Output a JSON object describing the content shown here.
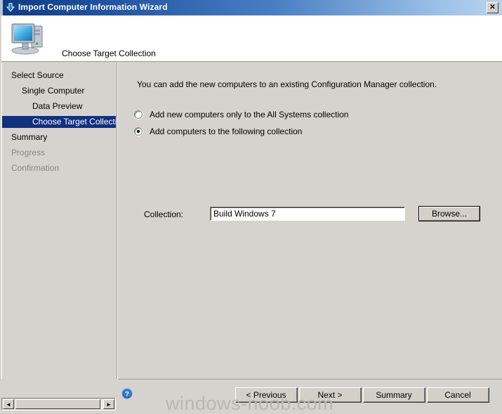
{
  "window": {
    "title": "Import Computer Information Wizard",
    "title_icon": "blue-down-arrow-icon",
    "close_label": "✕",
    "accent_color": "#1d4f9e",
    "body_color": "#d6d3ce",
    "selection_color": "#11307e"
  },
  "header": {
    "icon": "computer-monitor-icon",
    "title": "Choose Target Collection"
  },
  "nav": {
    "items": [
      {
        "label": "Select Source",
        "indent": 0,
        "state": "normal"
      },
      {
        "label": "Single Computer",
        "indent": 1,
        "state": "normal"
      },
      {
        "label": "Data Preview",
        "indent": 2,
        "state": "normal"
      },
      {
        "label": "Choose Target Collection",
        "indent": 2,
        "state": "selected"
      },
      {
        "label": "Summary",
        "indent": 0,
        "state": "normal"
      },
      {
        "label": "Progress",
        "indent": 0,
        "state": "disabled"
      },
      {
        "label": "Confirmation",
        "indent": 0,
        "state": "disabled"
      }
    ]
  },
  "main": {
    "intro": "You can add the new computers to an existing Configuration Manager collection.",
    "options": [
      {
        "label": "Add new computers only to the All Systems collection",
        "selected": false
      },
      {
        "label": "Add computers to the following collection",
        "selected": true
      }
    ],
    "collection": {
      "label": "Collection:",
      "value": "Build Windows 7",
      "placeholder": "",
      "browse_label": "Browse..."
    }
  },
  "footer": {
    "help_icon": "help-question-icon",
    "buttons": [
      {
        "label": "< Previous"
      },
      {
        "label": "Next >"
      },
      {
        "label": "Summary"
      },
      {
        "label": "Cancel"
      }
    ]
  },
  "watermark": {
    "text": "windows-noob.com"
  },
  "scrollbar": {
    "left_arrow": "◄",
    "right_arrow": "►"
  }
}
